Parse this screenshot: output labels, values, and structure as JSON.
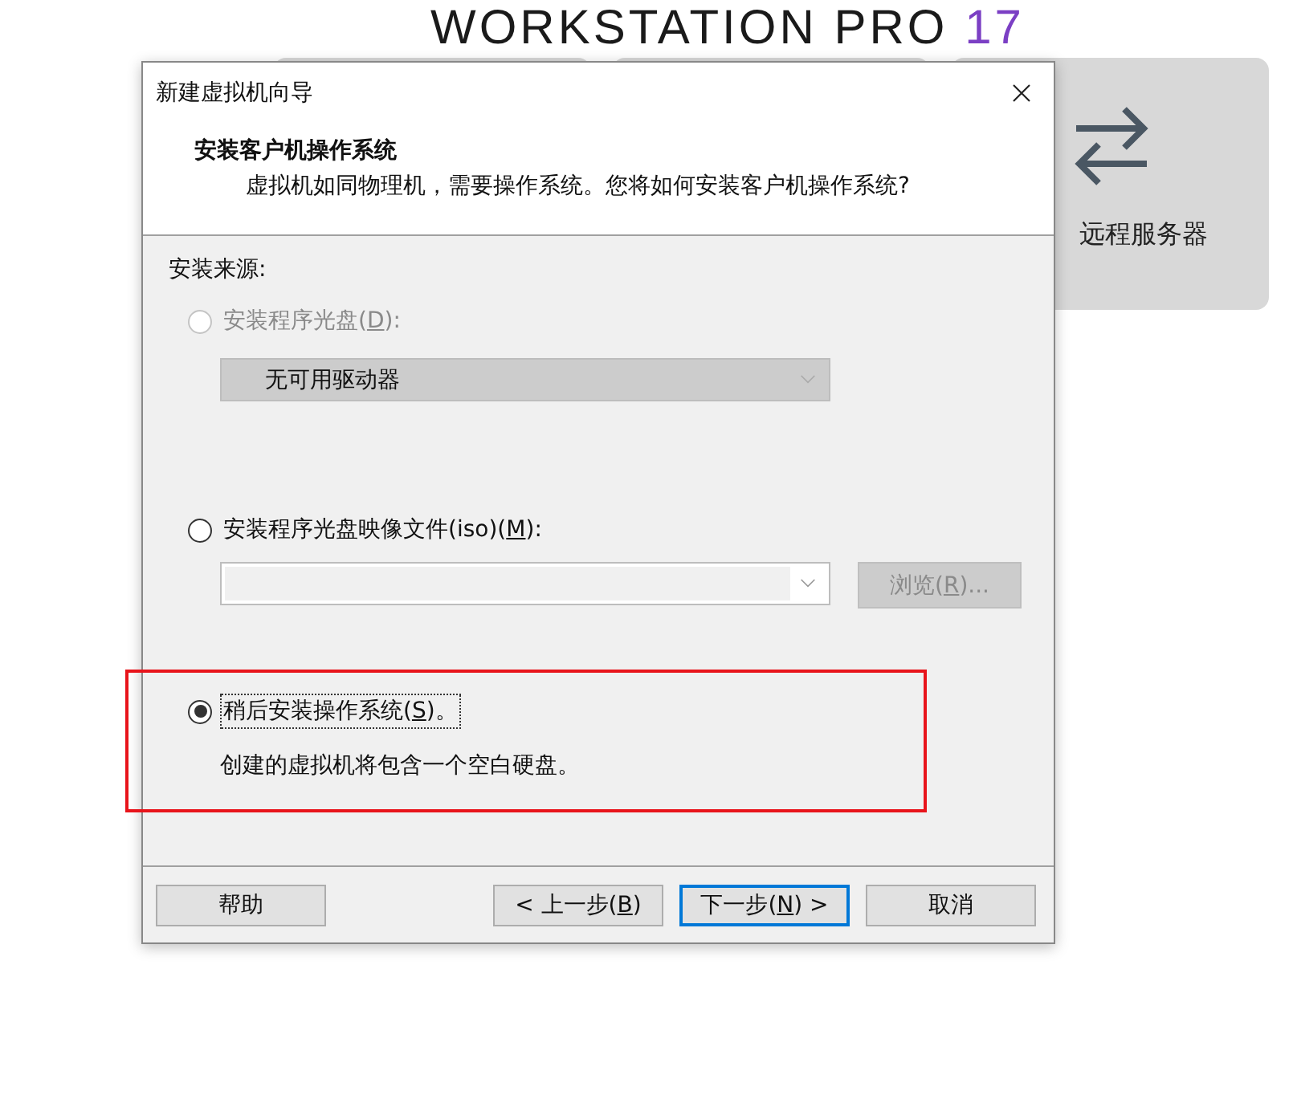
{
  "background": {
    "product": "WORKSTATION PRO",
    "version": "17",
    "cards": [
      {
        "kind": "blank"
      },
      {
        "kind": "blank"
      },
      {
        "kind": "action",
        "label": "远程服务器"
      }
    ]
  },
  "dialog": {
    "title": "新建虚拟机向导",
    "heading": "安装客户机操作系统",
    "subheading": "虚拟机如同物理机，需要操作系统。您将如何安装客户机操作系统?",
    "section_label": "安装来源:",
    "options": [
      {
        "kind": "drive",
        "before": "安装程序光盘(",
        "key": "D",
        "after": "):",
        "selected": false,
        "disabled": true,
        "dropdown": {
          "value": "无可用驱动器",
          "disabled": true
        }
      },
      {
        "kind": "iso",
        "before": "安装程序光盘映像文件(iso)(",
        "key": "M",
        "after": "):",
        "selected": false,
        "disabled": false,
        "browse": {
          "before": "浏览(",
          "key": "R",
          "after": ")...",
          "disabled": true
        }
      },
      {
        "kind": "later",
        "before": "稍后安装操作系统(",
        "key": "S",
        "after": ")。",
        "selected": true,
        "disabled": false,
        "description": "创建的虚拟机将包含一个空白硬盘。",
        "highlighted": true
      }
    ],
    "buttons": [
      {
        "before": "帮助",
        "default": false
      },
      {
        "before": "< 上一步(",
        "key": "B",
        "after": ")",
        "default": false
      },
      {
        "before": "下一步(",
        "key": "N",
        "after": ") >",
        "default": true
      },
      {
        "before": "取消",
        "default": false
      }
    ]
  }
}
